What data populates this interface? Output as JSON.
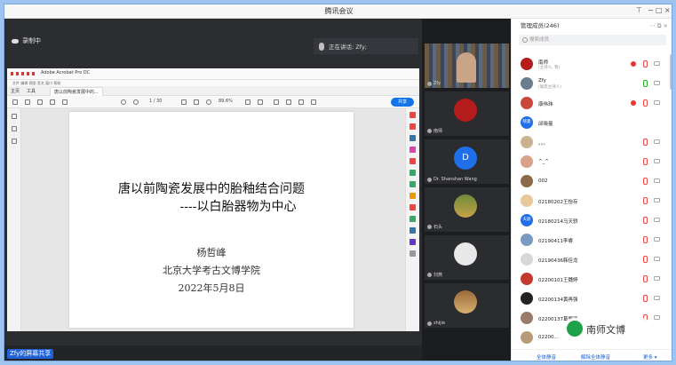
{
  "window": {
    "title": "腾讯会议"
  },
  "recording": {
    "label": "录制中"
  },
  "speaking": {
    "label": "正在讲话: Zfy;"
  },
  "acrobat": {
    "app_title": "Adobe Acrobat Pro DC",
    "menu": "文件  编辑  视图  签名  窗口  帮助",
    "tabs": [
      "主页",
      "工具",
      "唐以前陶瓷发展中的..."
    ],
    "page_indicator": "1 / 30",
    "zoom": "89.6%",
    "share_label": "共享"
  },
  "slide": {
    "title_line1": "唐以前陶瓷发展中的胎釉结合问题",
    "title_line2": "----以白胎器物为中心",
    "author": "杨哲峰",
    "affiliation": "北京大学考古文博学院",
    "date": "2022年5月8日"
  },
  "screen_share_tag": "Zfy的屏幕共享",
  "video_tiles": [
    {
      "name": "Zfy"
    },
    {
      "name": "南师"
    },
    {
      "name": "Dr. Shanshan Wang",
      "initial": "D"
    },
    {
      "name": "石头"
    },
    {
      "name": "刘燕"
    },
    {
      "name": "zhijie"
    }
  ],
  "members": {
    "header": "管理成员(246)",
    "search_placeholder": "搜索成员",
    "list": [
      {
        "name": "南师",
        "sub": "(主持人, 我)"
      },
      {
        "name": "Zfy",
        "sub": "(联席主持人)"
      },
      {
        "name": "康伟玮",
        "sub": ""
      },
      {
        "name": "邱晓曼",
        "sub": "",
        "avatar_text": "晓曼"
      },
      {
        "name": "。。。",
        "sub": ""
      },
      {
        "name": "^_^",
        "sub": ""
      },
      {
        "name": "002",
        "sub": ""
      },
      {
        "name": "02180202王怡存",
        "sub": ""
      },
      {
        "name": "02180214马天骄",
        "sub": "",
        "avatar_text": "天骄"
      },
      {
        "name": "02190411李睿",
        "sub": ""
      },
      {
        "name": "02190436韩佳龙",
        "sub": ""
      },
      {
        "name": "02200101王魏婷",
        "sub": ""
      },
      {
        "name": "02200134黄再强",
        "sub": ""
      },
      {
        "name": "02200137葛馨瑞",
        "sub": ""
      },
      {
        "name": "02200...",
        "sub": ""
      }
    ],
    "footer": [
      "全体静音",
      "解除全体静音",
      "更多 ▾"
    ]
  },
  "watermark": "南师文博",
  "colors": {
    "accent": "#1f62d8",
    "recording": "#e33333",
    "background": "#9ec3ef"
  }
}
